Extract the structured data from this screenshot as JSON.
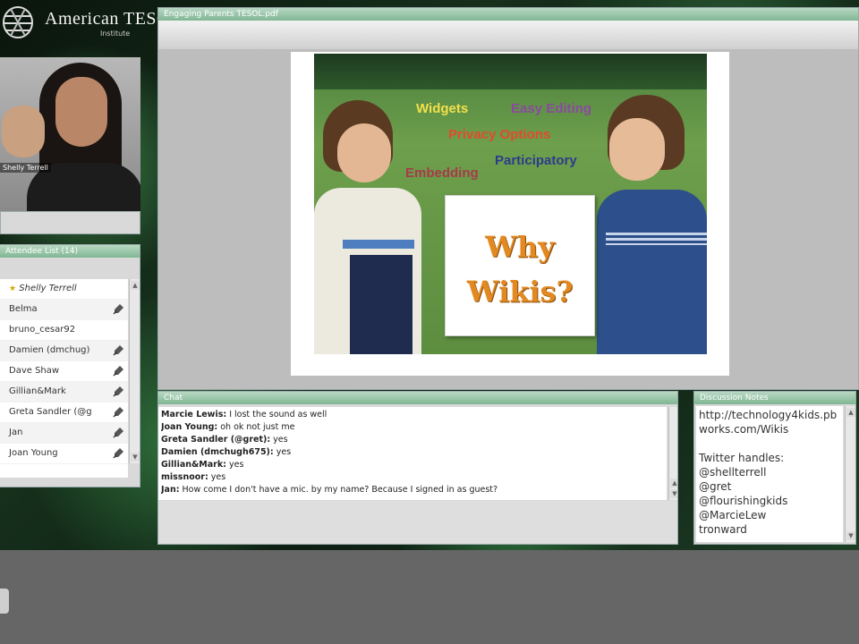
{
  "logo": {
    "name": "American TESOL",
    "sub": "Institute"
  },
  "webcam": {
    "presenter_label": "Shelly Terrell"
  },
  "attendees": {
    "title": "Attendee List (14)",
    "items": [
      {
        "name": "Shelly Terrell",
        "role": "host"
      },
      {
        "name": "Belma",
        "mic": true
      },
      {
        "name": "bruno_cesar92",
        "mic": false
      },
      {
        "name": "Damien (dmchug)",
        "mic": true
      },
      {
        "name": "Dave Shaw",
        "mic": true
      },
      {
        "name": "Gillian&Mark",
        "mic": true
      },
      {
        "name": "Greta Sandler (@g",
        "mic": true
      },
      {
        "name": "Jan",
        "mic": true
      },
      {
        "name": "Joan Young",
        "mic": true
      }
    ]
  },
  "pdf": {
    "title": "Engaging Parents TESOL.pdf",
    "slide": {
      "words": [
        {
          "text": "Widgets",
          "color": "#f2e04a"
        },
        {
          "text": "Easy Editing",
          "color": "#8a4aa0"
        },
        {
          "text": "Privacy Options",
          "color": "#e24b2c"
        },
        {
          "text": "Participatory",
          "color": "#2c3c8a"
        },
        {
          "text": "Embedding",
          "color": "#a83a4a"
        }
      ],
      "sign_line1": "Why",
      "sign_line2": "Wikis?"
    }
  },
  "chat": {
    "title": "Chat",
    "messages": [
      {
        "user": "Marcie Lewis:",
        "text": " I lost the sound as well"
      },
      {
        "user": "Joan Young:",
        "text": " oh ok not just me"
      },
      {
        "user": "Greta Sandler (@gret):",
        "text": " yes"
      },
      {
        "user": "Damien (dmchugh675):",
        "text": " yes"
      },
      {
        "user": "Gillian&Mark:",
        "text": " yes"
      },
      {
        "user": "missnoor:",
        "text": " yes"
      },
      {
        "user": "Jan:",
        "text": " How come I don't have a mic. by my name? Because I signed in as guest?"
      }
    ]
  },
  "notes": {
    "title": "Discussion Notes",
    "lines": [
      "http://technology4kids.pb",
      "works.com/Wikis",
      "",
      "Twitter handles:",
      "@shellterrell",
      "@gret",
      "@flourishingkids",
      "@MarcieLew",
      "tronward"
    ]
  }
}
